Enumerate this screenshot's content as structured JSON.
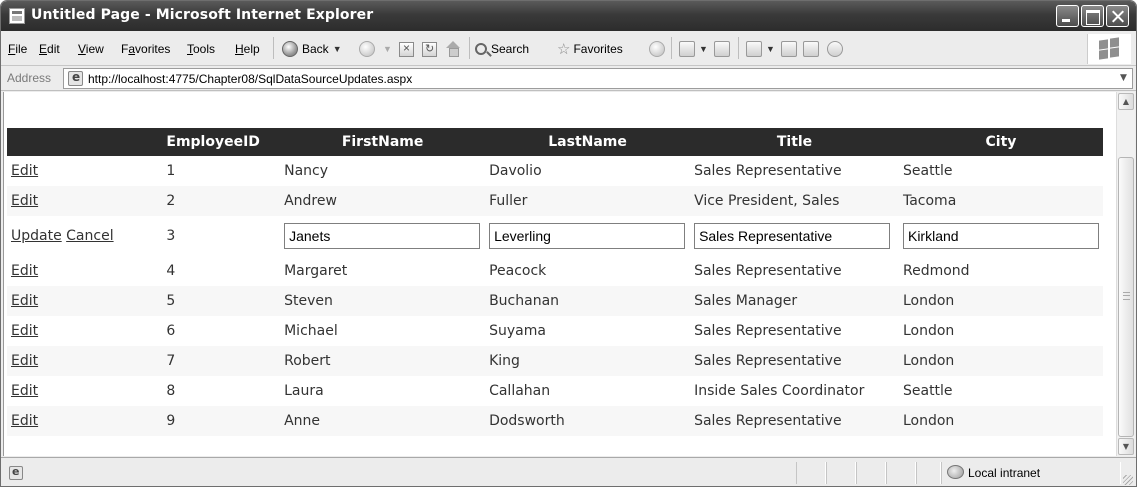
{
  "window": {
    "title": "Untitled Page - Microsoft Internet Explorer"
  },
  "menu": {
    "items": [
      {
        "first": "F",
        "rest": "ile"
      },
      {
        "first": "E",
        "rest": "dit"
      },
      {
        "first": "V",
        "rest": "iew"
      },
      {
        "pre": "F",
        "first": "a",
        "rest": "vorites"
      },
      {
        "first": "T",
        "rest": "ools"
      },
      {
        "first": "H",
        "rest": "elp"
      }
    ]
  },
  "toolbar": {
    "back_label": "Back",
    "search_label": "Search",
    "favorites_label": "Favorites"
  },
  "address": {
    "label": "Address",
    "url": "http://localhost:4775/Chapter08/SqlDataSourceUpdates.aspx"
  },
  "grid": {
    "headers": [
      "",
      "EmployeeID",
      "FirstName",
      "LastName",
      "Title",
      "City"
    ],
    "edit_label": "Edit",
    "update_label": "Update",
    "cancel_label": "Cancel",
    "rows": [
      {
        "id": "1",
        "first": "Nancy",
        "last": "Davolio",
        "title": "Sales Representative",
        "city": "Seattle"
      },
      {
        "id": "2",
        "first": "Andrew",
        "last": "Fuller",
        "title": "Vice President, Sales",
        "city": "Tacoma"
      },
      {
        "id": "3",
        "first": "Janets",
        "last": "Leverling",
        "title": "Sales Representative",
        "city": "Kirkland"
      },
      {
        "id": "4",
        "first": "Margaret",
        "last": "Peacock",
        "title": "Sales Representative",
        "city": "Redmond"
      },
      {
        "id": "5",
        "first": "Steven",
        "last": "Buchanan",
        "title": "Sales Manager",
        "city": "London"
      },
      {
        "id": "6",
        "first": "Michael",
        "last": "Suyama",
        "title": "Sales Representative",
        "city": "London"
      },
      {
        "id": "7",
        "first": "Robert",
        "last": "King",
        "title": "Sales Representative",
        "city": "London"
      },
      {
        "id": "8",
        "first": "Laura",
        "last": "Callahan",
        "title": "Inside Sales Coordinator",
        "city": "Seattle"
      },
      {
        "id": "9",
        "first": "Anne",
        "last": "Dodsworth",
        "title": "Sales Representative",
        "city": "London"
      }
    ]
  },
  "status": {
    "zone": "Local intranet"
  }
}
